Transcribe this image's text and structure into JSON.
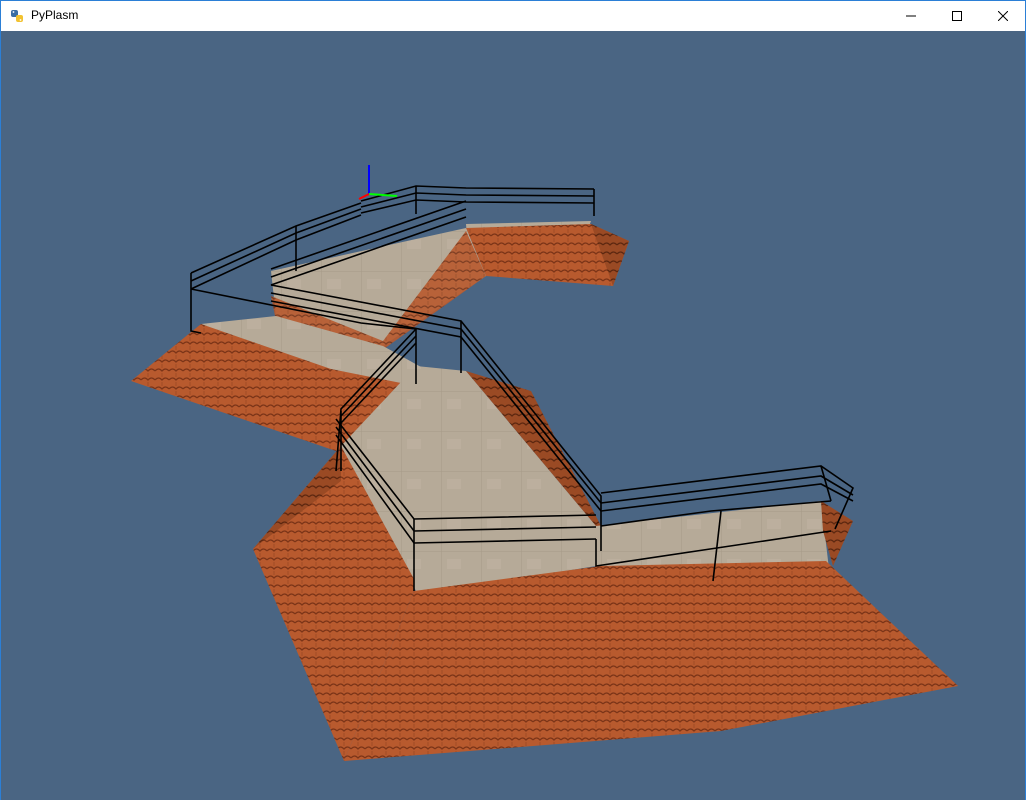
{
  "window": {
    "title": "PyPlasm",
    "icon": "python-icon",
    "controls": [
      "minimize-icon",
      "maximize-icon",
      "close-icon"
    ]
  },
  "viewport": {
    "background_color": "#4a6583",
    "roof_color": "#b85a2e",
    "walkway_color": "#b6aa98",
    "railing_color": "#000000",
    "axis_colors": {
      "x": "#ff0000",
      "y": "#00ff00",
      "z": "#0000ff"
    }
  }
}
